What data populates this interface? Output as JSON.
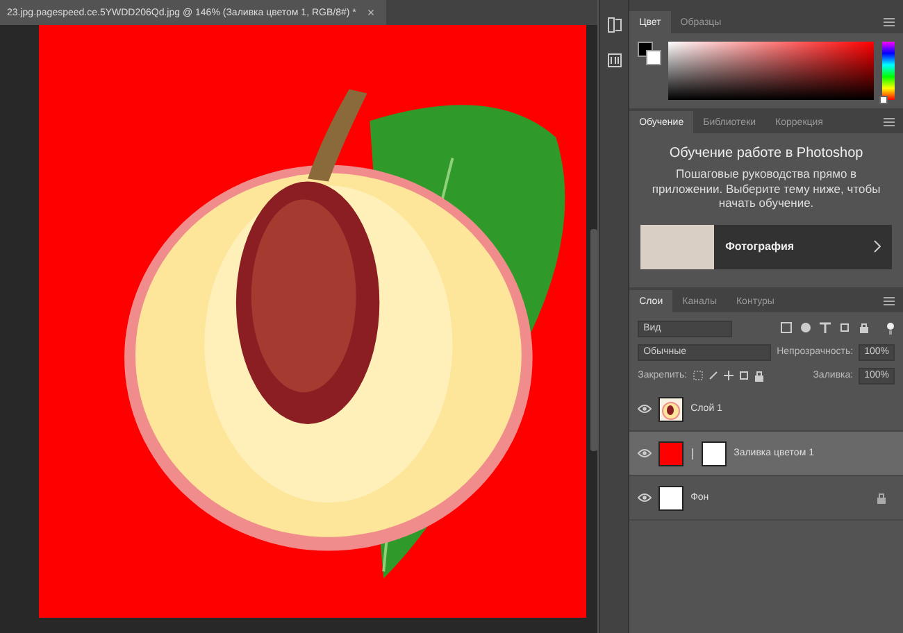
{
  "document": {
    "tab_title": "23.jpg.pagespeed.ce.5YWDD206Qd.jpg @ 146% (Заливка цветом 1, RGB/8#) *",
    "close": "×"
  },
  "color_panel": {
    "tabs": [
      {
        "label": "Цвет",
        "selected": true
      },
      {
        "label": "Образцы",
        "selected": false
      }
    ],
    "hue": {
      "level": 0
    }
  },
  "learn_panel": {
    "tabs": [
      {
        "label": "Обучение",
        "selected": true
      },
      {
        "label": "Библиотеки",
        "selected": false
      },
      {
        "label": "Коррекция",
        "selected": false
      }
    ],
    "title": "Обучение работе в Photoshop",
    "description": "Пошаговые руководства прямо в приложении. Выберите тему ниже, чтобы начать обучение.",
    "cards": [
      {
        "label": "Фотография"
      }
    ]
  },
  "layers_panel": {
    "tabs": [
      {
        "label": "Слои",
        "selected": true
      },
      {
        "label": "Каналы",
        "selected": false
      },
      {
        "label": "Контуры",
        "selected": false
      }
    ],
    "filter": "Вид",
    "blend_mode": "Обычные",
    "opacity_label": "Непрозрачность:",
    "opacity": "100%",
    "lock_label": "Закрепить:",
    "fill_label": "Заливка:",
    "fill": "100%",
    "layers": [
      {
        "name": "Слой 1",
        "kind": "image",
        "visible": true,
        "selected": false,
        "locked": false
      },
      {
        "name": "Заливка цветом 1",
        "kind": "fill",
        "visible": true,
        "selected": true,
        "locked": false
      },
      {
        "name": "Фон",
        "kind": "background",
        "visible": true,
        "selected": false,
        "locked": true
      }
    ]
  }
}
